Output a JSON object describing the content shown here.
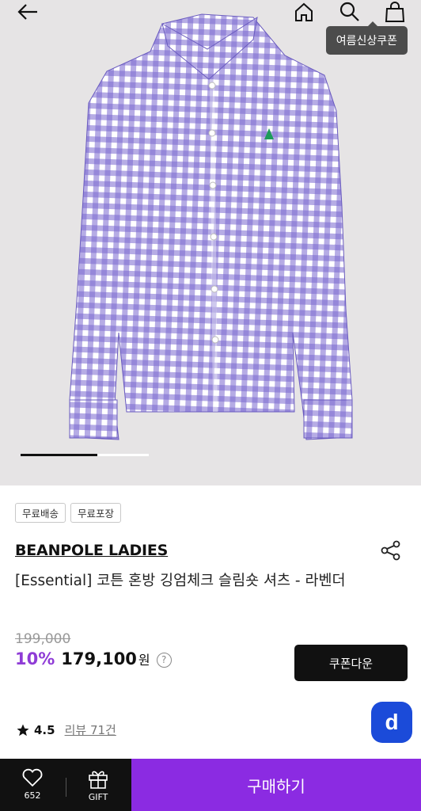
{
  "header": {
    "back_icon": "arrow-left-icon",
    "home_icon": "home-icon",
    "search_icon": "search-icon",
    "cart_icon": "shopping-bag-icon",
    "coupon_tooltip": "여름신상쿠폰"
  },
  "gallery": {
    "image_description": "lavender gingham check long-sleeve shirt",
    "progress": 0.6
  },
  "product": {
    "tags": [
      "무료배송",
      "무료포장"
    ],
    "brand": "BEANPOLE LADIES",
    "title": "[Essential] 코튼 혼방 깅엄체크 슬림숏 셔츠 - 라벤더",
    "original_price": "199,000",
    "discount": "10%",
    "price": "179,100",
    "currency": "원",
    "help_symbol": "?",
    "coupon_button": "쿠폰다운",
    "rating": "4.5",
    "review_link": "리뷰 71건",
    "floating_button": "d"
  },
  "bottom_bar": {
    "like_count": "652",
    "gift_label": "GIFT",
    "buy_label": "구매하기"
  },
  "colors": {
    "accent": "#8b2be2",
    "discount": "#8f3cd6",
    "floating": "#1b4bd9",
    "gingham": "#7a68cf"
  }
}
